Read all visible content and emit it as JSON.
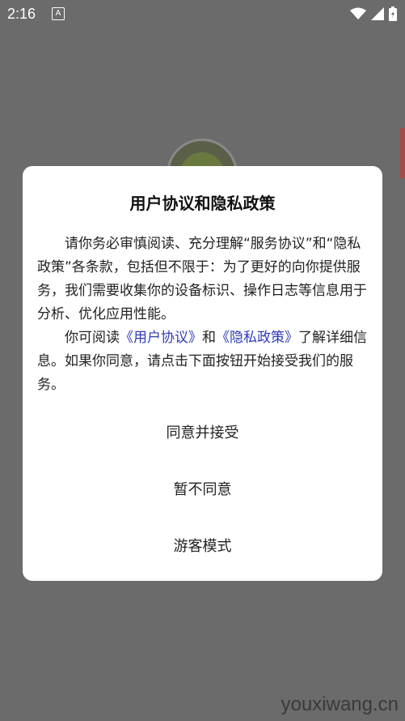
{
  "status_bar": {
    "time": "2:16",
    "notification_icon_label": "A"
  },
  "dialog": {
    "title": "用户协议和隐私政策",
    "paragraph1": "请你务必审慎阅读、充分理解“服务协议”和“隐私政策”各条款，包括但不限于：为了更好的向你提供服务，我们需要收集你的设备标识、操作日志等信息用于分析、优化应用性能。",
    "paragraph2_prefix": "你可阅读",
    "link_user_agreement": "《用户协议》",
    "paragraph2_and": "和",
    "link_privacy_policy": "《隐私政策》",
    "paragraph2_suffix": "了解详细信息。如果你同意，请点击下面按钮开始接受我们的服务。",
    "buttons": {
      "agree": "同意并接受",
      "disagree": "暂不同意",
      "guest": "游客模式"
    }
  },
  "watermark": "youxiwang.cn",
  "colors": {
    "overlay": "#6b6b6b",
    "link": "#2d3bb5",
    "dialog_bg": "#ffffff"
  }
}
